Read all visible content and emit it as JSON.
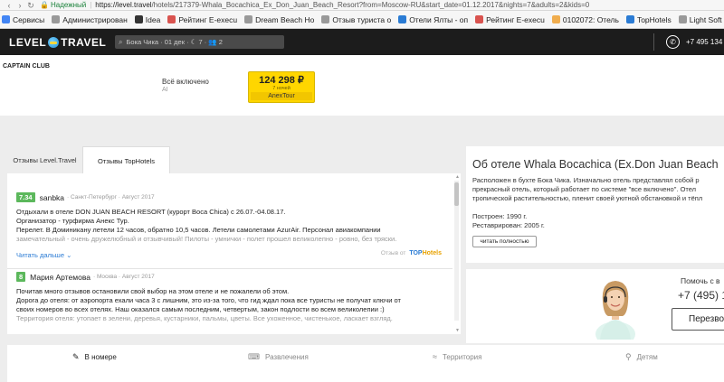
{
  "browser": {
    "secure_label": "Надежный",
    "url_host": "https://level.travel",
    "url_path": "/hotels/217379-Whala_Bocachica_Ex_Don_Juan_Beach_Resort?from=Moscow-RU&start_date=01.12.2017&nights=7&adults=2&kids=0",
    "bookmarks": [
      {
        "label": "Сервисы",
        "color": "#4285f4"
      },
      {
        "label": "Администрирован",
        "color": "#999999"
      },
      {
        "label": "Idea",
        "color": "#333333"
      },
      {
        "label": "Рейтинг E-execu",
        "color": "#d9534f"
      },
      {
        "label": "Dream Beach Ho",
        "color": "#999999"
      },
      {
        "label": "Отзыв туриста о",
        "color": "#999999"
      },
      {
        "label": "Отели Ялты - оп",
        "color": "#2a7bd4"
      },
      {
        "label": "Рейтинг E-execu",
        "color": "#d9534f"
      },
      {
        "label": "0102072: Отель",
        "color": "#f0ad4e"
      },
      {
        "label": "TopHotels",
        "color": "#2a7bd4"
      },
      {
        "label": "Light Soft Travel",
        "color": "#999999"
      }
    ]
  },
  "header": {
    "logo_left": "LEVEL",
    "logo_right": "TRAVEL",
    "search_text": "Бока Чика · 01 дек · ☾ 7 · 👥 2",
    "phone": "+7 495 134"
  },
  "offer": {
    "club": "CAPTAIN CLUB",
    "room": "Всё включено",
    "meal": "AI",
    "price": "124 298 ₽",
    "nights": "7 ночей",
    "operator": "AnexTour"
  },
  "tabs": {
    "level_travel": "Отзывы Level.Travel",
    "tophotels": "Отзывы TopHotels"
  },
  "reviews": [
    {
      "score": "7.34",
      "name": "sanbka",
      "meta": "· Санкт-Петербург · Август 2017",
      "lines": [
        "Отдыхали в отеле DON JUAN BEACH RESORT (курорт Boca Chica) с 26.07.-04.08.17.",
        "Организатор - турфирма Анекс Тур.",
        "Перелет. В Доминикану летели 12 часов, обратно 10,5 часов. Летели самолетами AzurAir. Персонал авиакомпании",
        "замечательный - очень дружелюбный и отзывчивый! Пилоты - умнички - полет прошел великолепно - ровно, без тряски."
      ],
      "read_more": "Читать дальше",
      "source_label": "Отзыв от",
      "source_logo": "TOP",
      "source_logo_b": "Hotels"
    },
    {
      "score": "8",
      "name": "Мария Артемова",
      "meta": "· Москва · Август 2017",
      "lines": [
        "Почитав много отзывов остановили свой выбор на этом отеле и не пожалели об этом.",
        "Дорога до отеля: от аэропорта ехали часа 3 с лишним, это из-за того, что гид ждал пока все туристы не получат ключи от",
        "своих номеров во всех отелях. Наш оказался самым последним, четвертым, закон подлости во всем великолепии :)",
        "Территория отеля: утопает в зелени, деревья, кустарники, пальмы, цветы. Все ухоженное, чистенькое, ласкает взгляд."
      ]
    }
  ],
  "about": {
    "title": "Об отеле Whala Bocachica (Ex.Don Juan Beach",
    "lines": [
      "Расположен в бухте Бока Чика. Изначально отель представлял собой р",
      "прекрасный отель, который работает по системе \"все включено\". Отел",
      "тропической растительностью, пленит своей уютной обстановкой и тёпл"
    ],
    "built": "Построен: 1990 г.",
    "renovated": "Реставрирован: 2005 г.",
    "read_full": "читать полностью"
  },
  "help": {
    "title": "Помочь с в",
    "phone": "+7 (495) 1",
    "callback": "Перезво"
  },
  "bottom_tabs": [
    {
      "label": "В номере",
      "icon": "brush-icon"
    },
    {
      "label": "Развлечения",
      "icon": "gamepad-icon"
    },
    {
      "label": "Территория",
      "icon": "pool-icon"
    },
    {
      "label": "Детям",
      "icon": "stroller-icon"
    }
  ]
}
